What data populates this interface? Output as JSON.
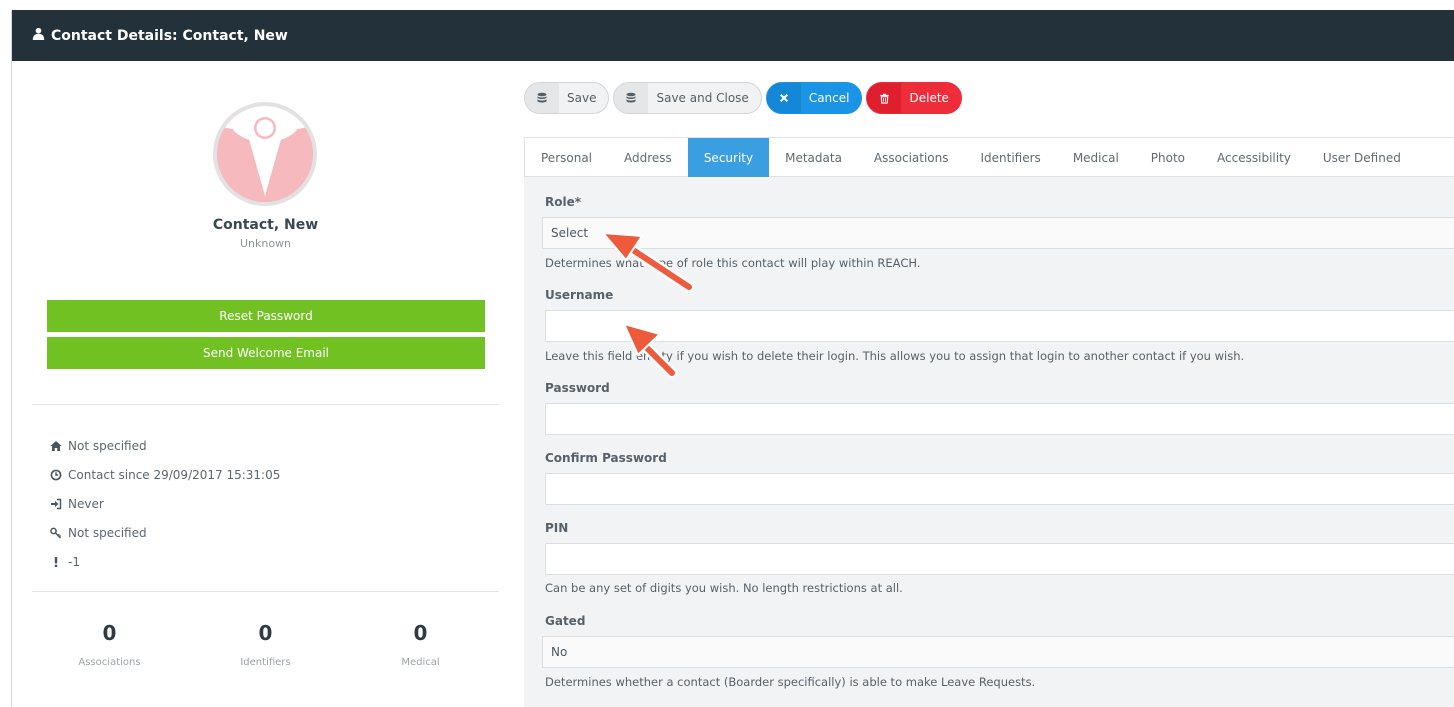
{
  "window": {
    "title": "Contact Details: Contact, New"
  },
  "profile": {
    "name": "Contact, New",
    "subtitle": "Unknown",
    "reset_password_label": "Reset Password",
    "send_welcome_label": "Send Welcome Email"
  },
  "info": {
    "address": "Not specified",
    "contact_since": "Contact since 29/09/2017 15:31:05",
    "last_login": "Never",
    "key": "Not specified",
    "alert": "-1"
  },
  "stats": [
    {
      "value": "0",
      "label": "Associations"
    },
    {
      "value": "0",
      "label": "Identifiers"
    },
    {
      "value": "0",
      "label": "Medical"
    }
  ],
  "toolbar": {
    "save_label": "Save",
    "save_close_label": "Save and Close",
    "cancel_label": "Cancel",
    "delete_label": "Delete"
  },
  "tabs": [
    {
      "label": "Personal"
    },
    {
      "label": "Address"
    },
    {
      "label": "Security"
    },
    {
      "label": "Metadata"
    },
    {
      "label": "Associations"
    },
    {
      "label": "Identifiers"
    },
    {
      "label": "Medical"
    },
    {
      "label": "Photo"
    },
    {
      "label": "Accessibility"
    },
    {
      "label": "User Defined"
    }
  ],
  "form": {
    "role": {
      "label": "Role*",
      "value": "Select",
      "help": "Determines what type of role this contact will play within REACH."
    },
    "username": {
      "label": "Username",
      "value": "",
      "help": "Leave this field empty if you wish to delete their login. This allows you to assign that login to another contact if you wish."
    },
    "password": {
      "label": "Password",
      "value": ""
    },
    "confirm_password": {
      "label": "Confirm Password",
      "value": ""
    },
    "pin": {
      "label": "PIN",
      "value": "",
      "help": "Can be any set of digits you wish. No length restrictions at all."
    },
    "gated": {
      "label": "Gated",
      "value": "No",
      "help": "Determines whether a contact (Boarder specifically) is able to make Leave Requests."
    }
  },
  "colors": {
    "titlebar": "#22313a",
    "green": "#72c122",
    "blue": "#1b94e6",
    "red": "#ef2c3a",
    "active_tab": "#3a9fe0",
    "annotation_arrow": "#ee5a3c"
  }
}
